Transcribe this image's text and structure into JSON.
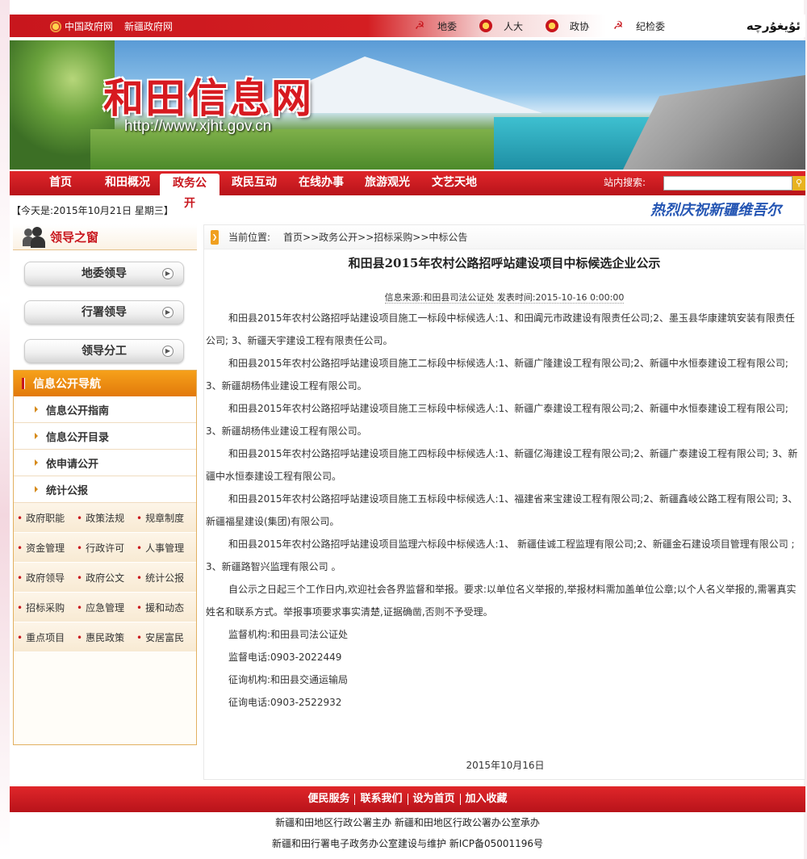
{
  "topbar": {
    "links_left": [
      "中国政府网",
      "新疆政府网"
    ],
    "links_right": [
      "地委",
      "人大",
      "政协",
      "纪检委"
    ],
    "uyghur_text": "ئۇيغۇرچە"
  },
  "banner": {
    "title": "和田信息网",
    "url": "http://www.xjht.gov.cn"
  },
  "nav": {
    "items": [
      "首页",
      "和田概况",
      "政务公开",
      "政民互动",
      "在线办事",
      "旅游观光",
      "文艺天地"
    ],
    "active": "政务公开",
    "search_label": "站内搜索:"
  },
  "datebar": {
    "today": "【今天是:2015年10月21日 星期三】",
    "marquee": "热烈庆祝新疆维吾尔"
  },
  "leaders": {
    "title": "领导之窗",
    "buttons": [
      "地委领导",
      "行署领导",
      "领导分工"
    ]
  },
  "info_nav": {
    "title": "信息公开导航",
    "items": [
      "信息公开指南",
      "信息公开目录",
      "依申请公开",
      "统计公报"
    ],
    "grid": [
      [
        "政府职能",
        "政策法规",
        "规章制度"
      ],
      [
        "资金管理",
        "行政许可",
        "人事管理"
      ],
      [
        "政府领导",
        "政府公文",
        "统计公报"
      ],
      [
        "招标采购",
        "应急管理",
        "援和动态"
      ],
      [
        "重点项目",
        "惠民政策",
        "安居富民"
      ]
    ]
  },
  "article": {
    "location_label": "当前位置:",
    "breadcrumb": "首页>>政务公开>>招标采购>>中标公告",
    "title": "和田县2015年农村公路招呼站建设项目中标候选企业公示",
    "meta": "信息来源:和田县司法公证处 发表时间:2015-10-16 0:00:00",
    "paragraphs": [
      "和田县2015年农村公路招呼站建设项目施工一标段中标候选人:1、和田阗元市政建设有限责任公司;2、墨玉县华康建筑安装有限责任公司; 3、新疆天宇建设工程有限责任公司。",
      "和田县2015年农村公路招呼站建设项目施工二标段中标候选人:1、新疆广隆建设工程有限公司;2、新疆中水恒泰建设工程有限公司; 3、新疆胡杨伟业建设工程有限公司。",
      "和田县2015年农村公路招呼站建设项目施工三标段中标候选人:1、新疆广泰建设工程有限公司;2、新疆中水恒泰建设工程有限公司; 3、新疆胡杨伟业建设工程有限公司。",
      "和田县2015年农村公路招呼站建设项目施工四标段中标候选人:1、新疆亿海建设工程有限公司;2、新疆广泰建设工程有限公司; 3、新疆中水恒泰建设工程有限公司。",
      "和田县2015年农村公路招呼站建设项目施工五标段中标候选人:1、福建省来宝建设工程有限公司;2、新疆鑫岐公路工程有限公司; 3、新疆福星建设(集团)有限公司。",
      "和田县2015年农村公路招呼站建设项目监理六标段中标候选人:1、 新疆佳诚工程监理有限公司;2、新疆金石建设项目管理有限公司 ; 3、新疆路智兴监理有限公司 。",
      "自公示之日起三个工作日内,欢迎社会各界监督和举报。要求:以单位名义举报的,举报材料需加盖单位公章;以个人名义举报的,需署真实姓名和联系方式。举报事项要求事实清楚,证据确凿,否则不予受理。",
      "监督机构:和田县司法公证处",
      "监督电话:0903-2022449",
      "征询机构:和田县交通运输局",
      "征询电话:0903-2522932"
    ],
    "sign_date": "2015年10月16日"
  },
  "footer": {
    "links": [
      "便民服务",
      "联系我们",
      "设为首页",
      "加入收藏"
    ],
    "line1": "新疆和田地区行政公署主办 新疆和田地区行政公署办公室承办",
    "line2": "新疆和田行署电子政务办公室建设与维护 新ICP备05001196号"
  },
  "colors": {
    "brand_red": "#c8161d",
    "accent_orange": "#e2790b",
    "marquee_blue": "#2455b3"
  }
}
